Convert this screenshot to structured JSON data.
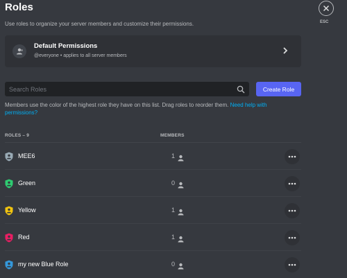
{
  "header": {
    "title": "Roles",
    "description": "Use roles to organize your server members and customize their permissions."
  },
  "default_permissions": {
    "title": "Default Permissions",
    "subtitle": "@everyone • applies to all server members",
    "icon": "people-icon"
  },
  "search": {
    "placeholder": "Search Roles"
  },
  "create_role_label": "Create Role",
  "help": {
    "text": "Members use the color of the highest role they have on this list. Drag roles to reorder them. ",
    "link": "Need help with permissions?"
  },
  "table": {
    "roles_header": "ROLES – 9",
    "members_header": "MEMBERS",
    "rows": [
      {
        "name": "MEE6",
        "members": "1",
        "color": "#99aab5"
      },
      {
        "name": "Green",
        "members": "0",
        "color": "#2ecc71"
      },
      {
        "name": "Yellow",
        "members": "1",
        "color": "#f1c40f"
      },
      {
        "name": "Red",
        "members": "1",
        "color": "#e91e63"
      },
      {
        "name": "my new Blue Role",
        "members": "0",
        "color": "#3498db"
      }
    ]
  },
  "close": {
    "label": "ESC"
  },
  "colors": {
    "background": "#36393f",
    "accent": "#5865f2",
    "link": "#00aff4"
  }
}
